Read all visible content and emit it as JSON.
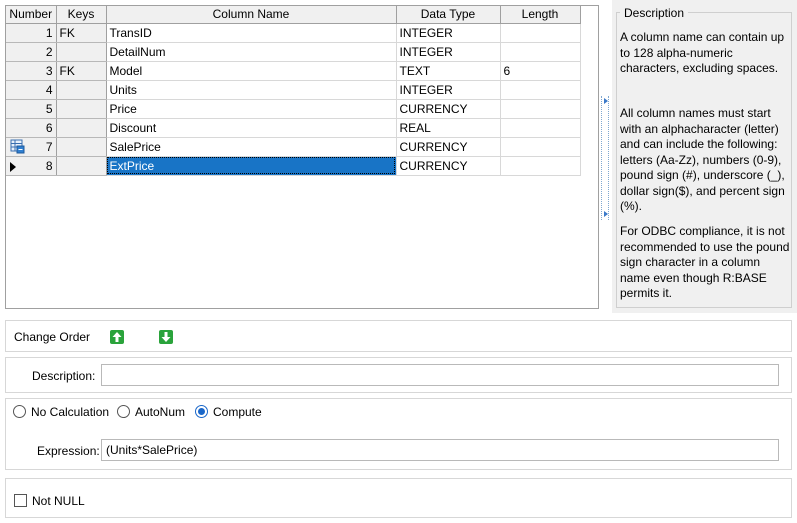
{
  "grid": {
    "headers": {
      "number": "Number",
      "keys": "Keys",
      "column_name": "Column Name",
      "data_type": "Data Type",
      "length": "Length"
    },
    "rows": [
      {
        "number": "1",
        "keys": "FK",
        "name": "TransID",
        "type": "INTEGER",
        "length": ""
      },
      {
        "number": "2",
        "keys": "",
        "name": "DetailNum",
        "type": "INTEGER",
        "length": ""
      },
      {
        "number": "3",
        "keys": "FK",
        "name": "Model",
        "type": "TEXT",
        "length": "6"
      },
      {
        "number": "4",
        "keys": "",
        "name": "Units",
        "type": "INTEGER",
        "length": ""
      },
      {
        "number": "5",
        "keys": "",
        "name": "Price",
        "type": "CURRENCY",
        "length": ""
      },
      {
        "number": "6",
        "keys": "",
        "name": "Discount",
        "type": "REAL",
        "length": ""
      },
      {
        "number": "7",
        "keys": "",
        "name": "SalePrice",
        "type": "CURRENCY",
        "length": ""
      },
      {
        "number": "8",
        "keys": "",
        "name": "ExtPrice",
        "type": "CURRENCY",
        "length": ""
      }
    ],
    "selected_row": "8"
  },
  "description_panel": {
    "title": "Description",
    "paragraph1": "A column name can contain up to 128 alpha-numeric characters, excluding spaces.",
    "paragraph2": "All column names must start with an alphacharacter (letter) and can include the following: letters (Aa-Zz), numbers (0-9), pound sign (#), underscore (_), dollar sign($), and percent sign (%).",
    "paragraph3": "For ODBC compliance, it is not recommended to use the pound sign character in a column name even though R:BASE permits it."
  },
  "change_order": {
    "label": "Change Order",
    "up_icon": "arrow-up-icon",
    "down_icon": "arrow-down-icon"
  },
  "description_field": {
    "label": "Description:",
    "value": ""
  },
  "calculation": {
    "options": [
      "No Calculation",
      "AutoNum",
      "Compute"
    ],
    "selected": "Compute",
    "expression_label": "Expression:",
    "expression_value": "(Units*SalePrice)"
  },
  "not_null": {
    "label": "Not NULL",
    "checked": false
  },
  "colors": {
    "selection": "#1874c6",
    "arrow_green": "#2aa33b",
    "radio_accent": "#1a67c9"
  }
}
